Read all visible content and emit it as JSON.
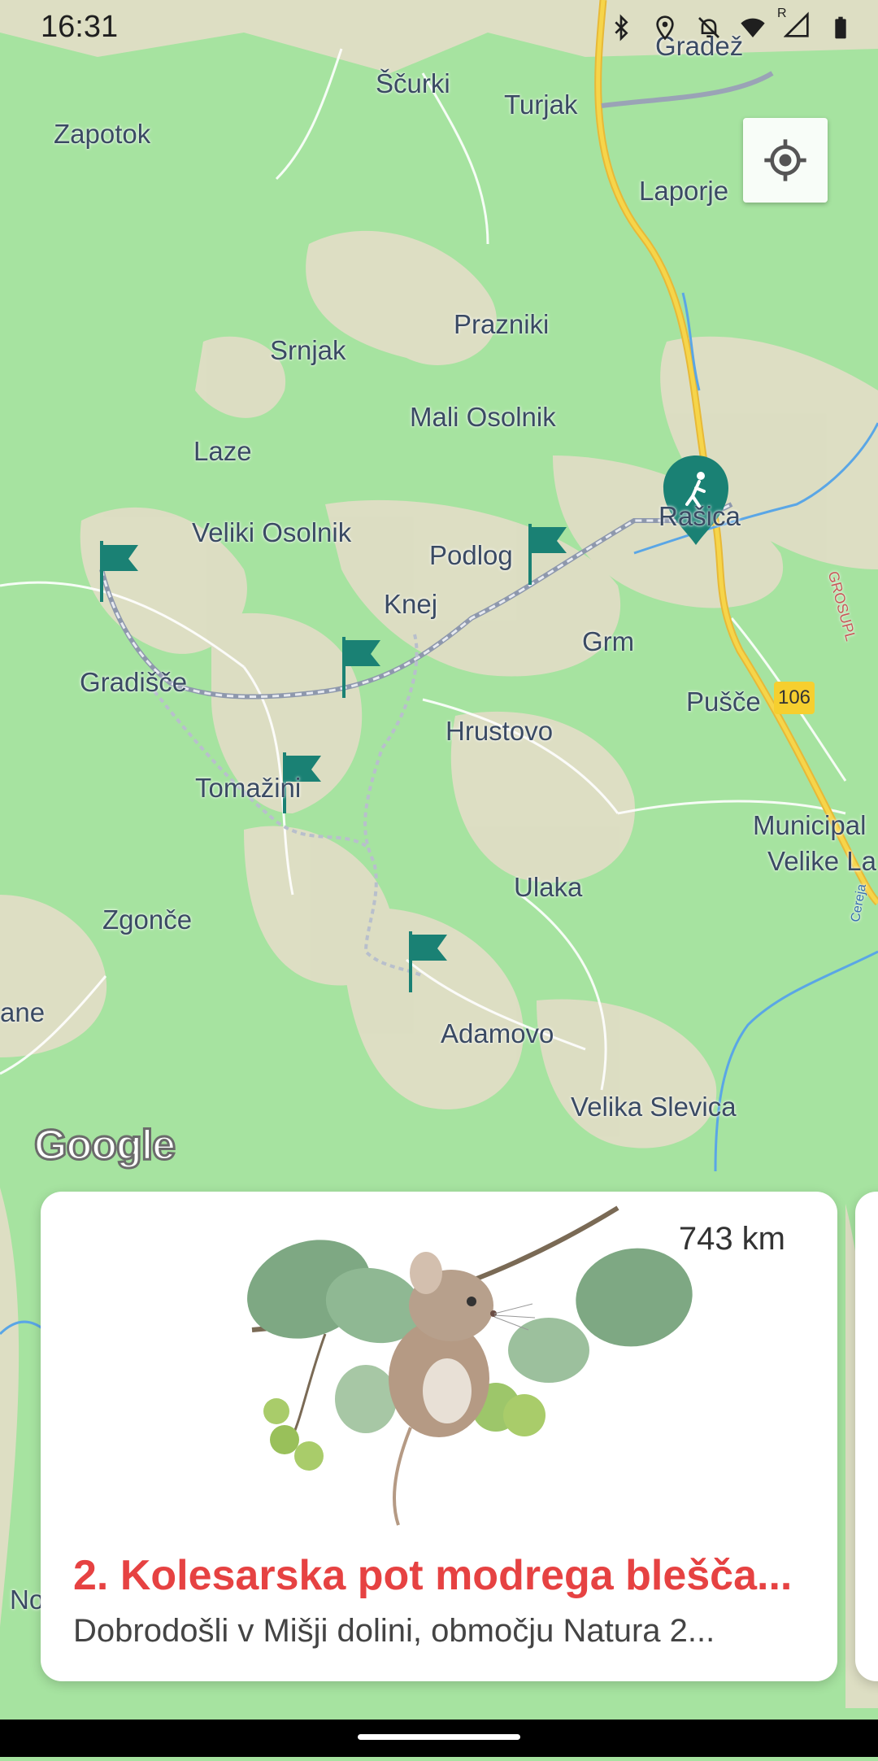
{
  "status_bar": {
    "time": "16:31",
    "icons": [
      "bluetooth-icon",
      "location-icon",
      "bell-off-icon",
      "wifi-icon",
      "signal-icon",
      "battery-icon"
    ],
    "roaming_indicator": "R"
  },
  "map": {
    "labels": {
      "gradez": "Gradež",
      "scurki": "Ščurki",
      "turjak": "Turjak",
      "zapotok": "Zapotok",
      "laporje": "Laporje",
      "prazniki": "Prazniki",
      "srnjak": "Srnjak",
      "mali_osolnik": "Mali Osolnik",
      "laze": "Laze",
      "rasica": "Rašica",
      "veliki_osolnik": "Veliki Osolnik",
      "podlog": "Podlog",
      "knej": "Knej",
      "grm": "Grm",
      "gradisce": "Gradišče",
      "pusce": "Pušče",
      "hrustovo": "Hrustovo",
      "tomazini": "Tomažini",
      "municipal": "Municipal",
      "velike_la": "Velike La",
      "ulaka": "Ulaka",
      "zgonce": "Zgonče",
      "ane": "ane",
      "adamovo": "Adamovo",
      "velika_slevica": "Velika Slevica",
      "no": "No",
      "grosuplje": "GROSUPL",
      "cereja": "Cereja"
    },
    "road_number": "106",
    "attribution": "Google",
    "colors": {
      "land": "#a6e3a0",
      "terrain": "#e6ddc9",
      "road_main": "#f6cf2f",
      "route": "#9aa3b6",
      "marker": "#1a8174",
      "water": "#5aa6e6"
    }
  },
  "locate_button": {
    "icon": "my-location-icon"
  },
  "card": {
    "distance": "743 km",
    "title": "2. Kolesarska pot modrega blešča...",
    "description": "Dobrodošli v Mišji dolini, območju Natura 2...",
    "image": "dormouse-illustration",
    "colors": {
      "title": "#e64242"
    }
  }
}
